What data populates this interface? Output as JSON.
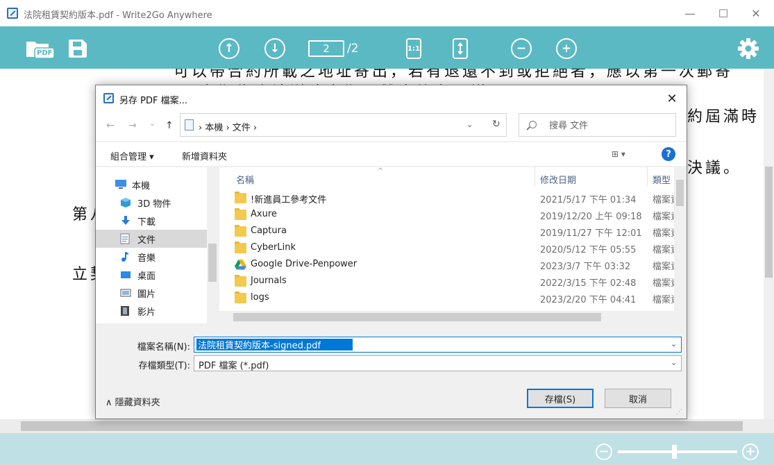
{
  "window": {
    "title": "法院租賃契約版本.pdf - Write2Go Anywhere",
    "minimize": "—",
    "maximize": "☐",
    "close": "✕"
  },
  "toolbar": {
    "pdf_label": "PDF",
    "page_up": "↑",
    "page_down": "↓",
    "current_page": "2",
    "page_total": "/2",
    "actual_size": "1:1",
    "zoom_out": "−",
    "zoom_in": "+",
    "accent_color": "#5bb9c4"
  },
  "document": {
    "lines": [
      "可以帶合約所載之地址寄出，若有退還不到或拒絕者，應以第一次郵寄",
      "之期為合法送達之期，雙方均有異議",
      "約屆滿時",
      "決議。",
      "第八",
      "立契"
    ]
  },
  "statusbar": {
    "zoom_out": "−",
    "zoom_in": "+",
    "zoom_level": 0.47
  },
  "dialog": {
    "title": "另存 PDF 檔案...",
    "close": "✕",
    "nav": {
      "back": "←",
      "forward": "→",
      "recent": "⌄",
      "up": "↑"
    },
    "address": "› 本機 › 文件 ›",
    "address_dropdown": "⌄",
    "refresh": "↻",
    "search_placeholder": "搜尋 文件",
    "organize": "組合管理 ▾",
    "new_folder": "新增資料夾",
    "view": "⊞ ▾",
    "help": "?",
    "nav_items": [
      {
        "label": "本機"
      },
      {
        "label": "3D 物件"
      },
      {
        "label": "下載"
      },
      {
        "label": "文件"
      },
      {
        "label": "音樂"
      },
      {
        "label": "桌面"
      },
      {
        "label": "圖片"
      },
      {
        "label": "影片"
      }
    ],
    "columns": {
      "name": "名稱",
      "date": "修改日期",
      "type": "類型"
    },
    "files": [
      {
        "name": "!新進員工參考文件",
        "date": "2021/5/17 下午 01:34",
        "type": "檔案資料夾",
        "icon": "folder"
      },
      {
        "name": "Axure",
        "date": "2019/12/20 上午 09:18",
        "type": "檔案資料夾",
        "icon": "folder"
      },
      {
        "name": "Captura",
        "date": "2019/11/27 下午 12:01",
        "type": "檔案資料夾",
        "icon": "folder"
      },
      {
        "name": "CyberLink",
        "date": "2020/5/12 下午 05:55",
        "type": "檔案資料夾",
        "icon": "folder"
      },
      {
        "name": "Google Drive-Penpower",
        "date": "2023/3/7 下午 03:32",
        "type": "檔案資料夾",
        "icon": "gdrive"
      },
      {
        "name": "Journals",
        "date": "2022/3/15 下午 02:48",
        "type": "檔案資料夾",
        "icon": "folder"
      },
      {
        "name": "logs",
        "date": "2023/2/20 下午 04:41",
        "type": "檔案資料夾",
        "icon": "folder"
      }
    ],
    "filename_label": "檔案名稱(N):",
    "filename_value": "法院租賃契約版本-signed.pdf",
    "filetype_label": "存檔類型(T):",
    "filetype_value": "PDF 檔案 (*.pdf)",
    "hide_folders": "∧ 隱藏資料夾",
    "save": "存檔(S)",
    "cancel": "取消"
  }
}
